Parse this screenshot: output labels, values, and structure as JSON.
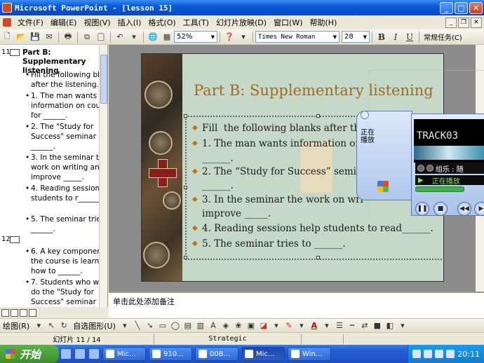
{
  "window": {
    "title": "Microsoft PowerPoint - [lesson 15]",
    "minimize": "_",
    "maximize": "□",
    "close": "✕"
  },
  "menu": {
    "items": [
      "文件(F)",
      "编辑(E)",
      "视图(V)",
      "插入(I)",
      "格式(O)",
      "工具(T)",
      "幻灯片放映(D)",
      "窗口(W)",
      "帮助(H)"
    ],
    "doc_close": "✕"
  },
  "toolbar": {
    "zoom": "52%",
    "font": "Times New Roman",
    "font_size": "28",
    "bold": "B",
    "italic": "I",
    "underline": "U",
    "task_pane": "常规任务(C)"
  },
  "outline": {
    "slide11": {
      "number": "11",
      "title": "Part B: Supplementary listening",
      "bullets": [
        "Fill  the following blanks after the listening.",
        "1. The man wants information on course for ______.",
        "2. The \"Study for Success\" seminar is for ______.",
        "3. In the seminar the work on writing and improve _____.",
        "4. Reading sessions help students to r______.",
        "5. The seminar tries to ______."
      ]
    },
    "slide12": {
      "number": "12",
      "bullets": [
        "6. A key component of the course is learning how to ______.",
        "7. Students who want to do the \"Study for Success\" seminar"
      ]
    }
  },
  "slide": {
    "title": "Part B: Supplementary listening",
    "bullets": [
      "Fill  the following blanks after the",
      "1. The man wants information on",
      "______.",
      "2. The “Study for Success” semi",
      "______.",
      "3. In the seminar the work on wri",
      "improve _____.",
      "4. Reading sessions help students to read______.",
      "5. The seminar tries to ______."
    ]
  },
  "player": {
    "track": "TRACK03",
    "group": "组乐 : 随",
    "status": "正在播放",
    "side_menu": "正在\n播放"
  },
  "notes": {
    "placeholder": "单击此处添加备注"
  },
  "drawbar": {
    "draw": "绘图(R)",
    "autoshapes": "自选图形(U)"
  },
  "status": {
    "slide": "幻灯片 11 / 14",
    "template": "Strategic"
  },
  "taskbar": {
    "start": "开始",
    "tasks": [
      "Mic...",
      "910...",
      "00B...",
      "Mic...",
      "Win..."
    ],
    "clock": "20:11"
  },
  "colors": {
    "title_bar": "#0A5AD8",
    "slide_bg": "#C6D8C8",
    "slide_title": "#A56A1E",
    "taskbar": "#245DD6"
  }
}
